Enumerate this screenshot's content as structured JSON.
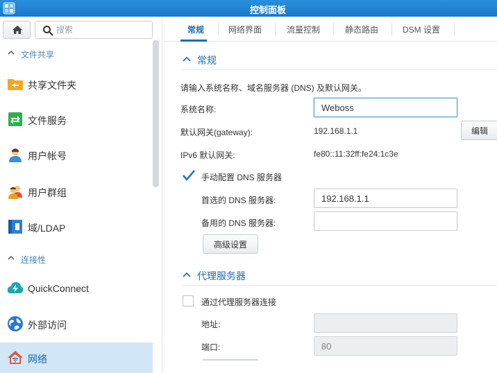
{
  "window": {
    "title": "控制面板"
  },
  "sidebar": {
    "search": {
      "placeholder": "搜索"
    },
    "sections": [
      {
        "label": "文件共享",
        "items": [
          {
            "label": "共享文件夹",
            "icon": "shared-folder-icon"
          },
          {
            "label": "文件服务",
            "icon": "file-services-icon"
          },
          {
            "label": "用户帐号",
            "icon": "user-icon"
          },
          {
            "label": "用户群组",
            "icon": "group-icon"
          },
          {
            "label": "域/LDAP",
            "icon": "domain-ldap-icon"
          }
        ]
      },
      {
        "label": "连接性",
        "items": [
          {
            "label": "QuickConnect",
            "icon": "quickconnect-icon"
          },
          {
            "label": "外部访问",
            "icon": "external-access-icon"
          },
          {
            "label": "网络",
            "icon": "network-icon",
            "active": true
          }
        ]
      }
    ]
  },
  "tabs": [
    {
      "label": "常规",
      "active": true
    },
    {
      "label": "网络界面"
    },
    {
      "label": "流量控制"
    },
    {
      "label": "静态路由"
    },
    {
      "label": "DSM 设置"
    }
  ],
  "general": {
    "title": "常规",
    "description": "请输入系统名称、域名服务器 (DNS) 及默认网关。",
    "server_name_label": "系统名称:",
    "server_name_value": "Weboss",
    "gateway_label": "默认网关(gateway):",
    "gateway_value": "192.168.1.1",
    "edit_button": "编辑",
    "ipv6_label": "IPv6 默认网关:",
    "ipv6_value": "fe80::11:32ff:fe24:1c3e",
    "manual_dns_label": "手动配置 DNS 服务器",
    "manual_dns_checked": true,
    "preferred_dns_label": "首选的 DNS 服务器:",
    "preferred_dns_value": "192.168.1.1",
    "alternate_dns_label": "备用的 DNS 服务器:",
    "alternate_dns_value": "",
    "advanced_button": "高级设置"
  },
  "proxy": {
    "title": "代理服务器",
    "connect_label": "通过代理服务器连接",
    "connect_checked": false,
    "address_label": "地址:",
    "address_value": "",
    "port_label": "端口:",
    "port_value": "80"
  },
  "colors": {
    "accent": "#1b6bb5",
    "titlebar": "#2184d4",
    "active_item": "#d1e6f7"
  }
}
